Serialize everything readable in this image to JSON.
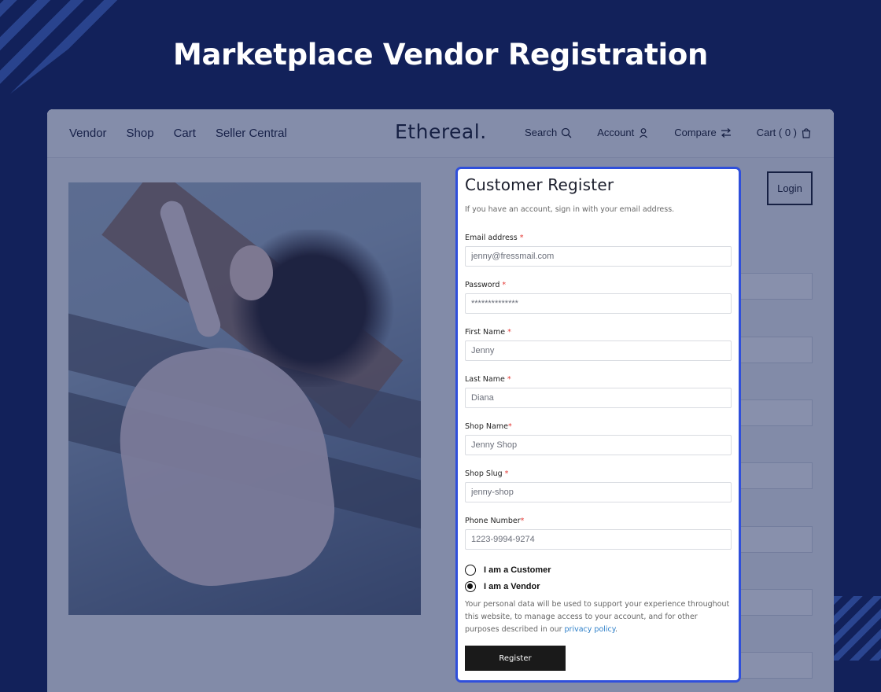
{
  "page": {
    "heading": "Marketplace Vendor Registration"
  },
  "nav": {
    "links": [
      "Vendor",
      "Shop",
      "Cart",
      "Seller Central"
    ],
    "brand": "Ethereal.",
    "search": "Search",
    "account": "Account",
    "compare": "Compare",
    "cart": "Cart ( 0 )"
  },
  "login_label": "Login",
  "form": {
    "title": "Customer Register",
    "subtitle": "If you have an account, sign in with your email address.",
    "fields": [
      {
        "label": "Email address",
        "required_mark": "*",
        "value": "jenny@fressmail.com"
      },
      {
        "label": "Password",
        "required_mark": "*",
        "value": "**************"
      },
      {
        "label": "First Name",
        "required_mark": "*",
        "value": "Jenny"
      },
      {
        "label": "Last Name",
        "required_mark": "*",
        "value": "Diana"
      },
      {
        "label": "Shop Name",
        "required_mark": "*",
        "value": "Jenny Shop"
      },
      {
        "label": "Shop Slug",
        "required_mark": "*",
        "value": "jenny-shop"
      },
      {
        "label": "Phone Number",
        "required_mark": "*",
        "value": "1223-9994-9274"
      }
    ],
    "radios": [
      {
        "label": "I am a Customer",
        "checked": false
      },
      {
        "label": "I am a Vendor",
        "checked": true
      }
    ],
    "privacy_text": "Your personal data will be used to support your experience throughout this website, to manage access to your account, and for other purposes described in our",
    "privacy_link": "privacy policy",
    "privacy_end": ".",
    "register_label": "Register"
  },
  "colors": {
    "background": "#12215a",
    "card_border": "#2f4fdb",
    "required": "#e53935",
    "link": "#2f80c9"
  }
}
